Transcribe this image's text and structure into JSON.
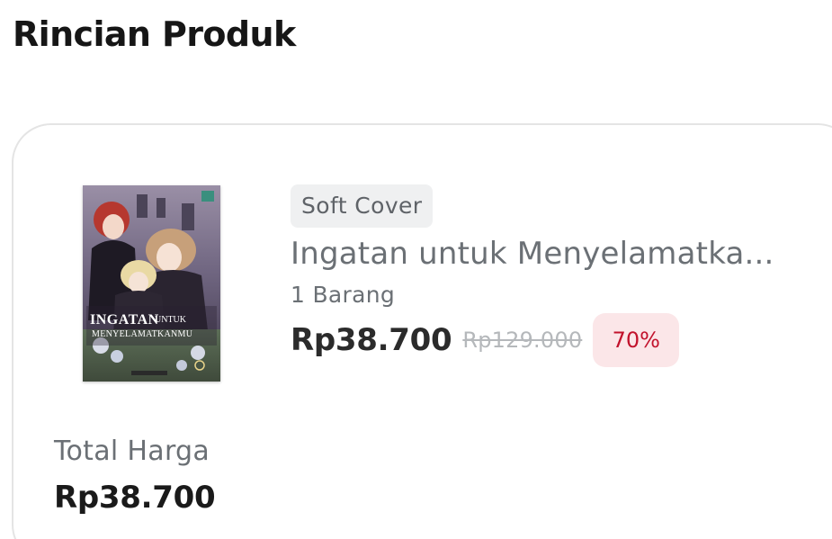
{
  "section": {
    "title": "Rincian Produk"
  },
  "product": {
    "variant": "Soft Cover",
    "title": "Ingatan untuk Menyelamatka...",
    "quantity": "1 Barang",
    "price": "Rp38.700",
    "original_price": "Rp129.000",
    "discount": "70%",
    "cover": {
      "title_line1": "INGATAN",
      "title_line2": "UNTUK",
      "title_line3": "MENYELAMATKANMU"
    }
  },
  "summary": {
    "total_label": "Total Harga",
    "total_value": "Rp38.700"
  },
  "colors": {
    "discount_text": "#c2122c",
    "discount_bg": "#fbe6e8",
    "variant_bg": "#eff0f1"
  }
}
